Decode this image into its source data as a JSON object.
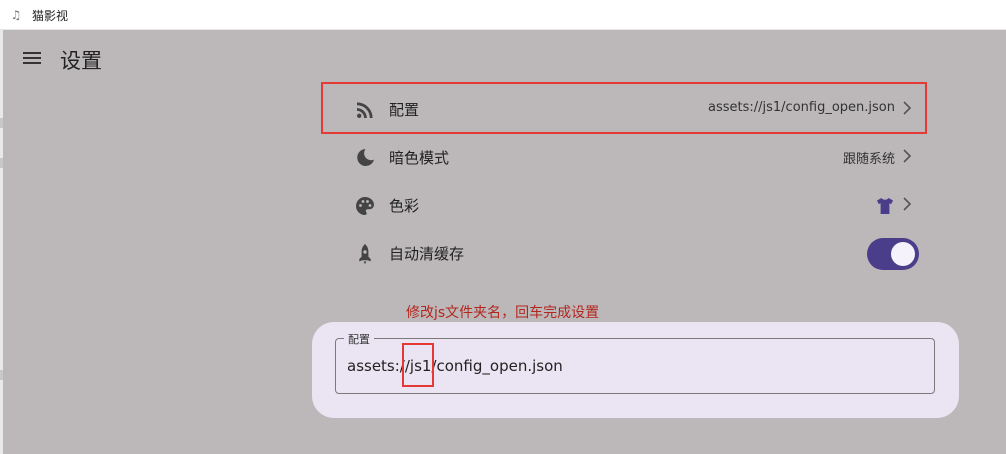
{
  "window": {
    "title": "猫影视",
    "app_icon": "music-note-icon"
  },
  "header": {
    "menu_icon": "menu-icon",
    "title": "设置"
  },
  "settings": {
    "items": [
      {
        "icon": "rss-feed-icon",
        "label": "配置",
        "value": "assets://js1/config_open.json",
        "chevron": "chevron-right-icon"
      },
      {
        "icon": "moon-icon",
        "label": "暗色模式",
        "value": "跟随系统",
        "chevron": "chevron-right-icon"
      },
      {
        "icon": "palette-icon",
        "label": "色彩",
        "value_icon": "tshirt-icon",
        "chevron": "chevron-right-icon"
      },
      {
        "icon": "rocket-icon",
        "label": "自动清缓存",
        "toggle_on": true
      }
    ]
  },
  "annotation": {
    "hint": "修改js文件夹名，回车完成设置"
  },
  "dialog": {
    "field_label": "配置",
    "field_value": "assets://js1/config_open.json"
  },
  "colors": {
    "background": "#bcb8b9",
    "accent": "#4a3d8a",
    "dialog": "#ebe5f3",
    "highlight": "#e53935",
    "hint_text": "#b3261e"
  }
}
